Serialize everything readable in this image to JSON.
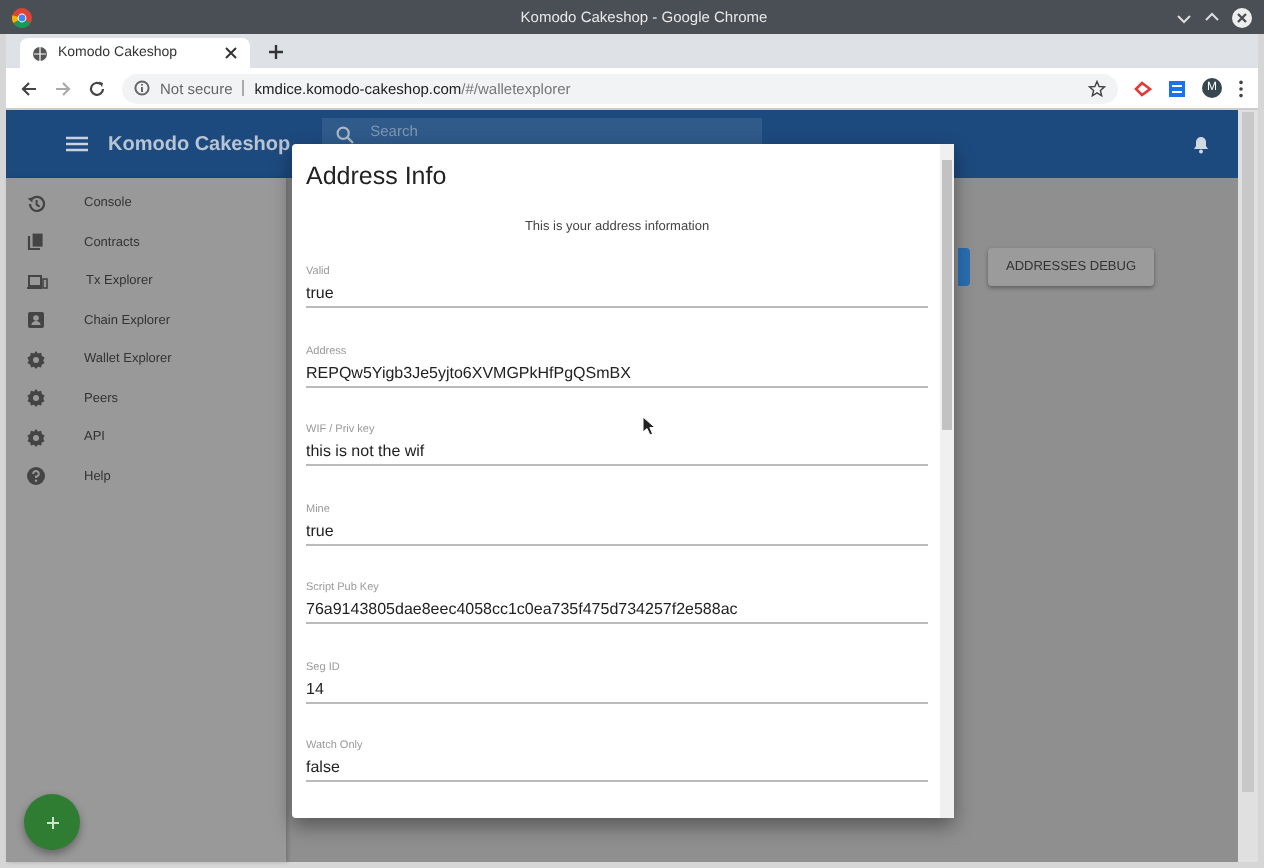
{
  "window": {
    "title": "Komodo Cakeshop - Google Chrome"
  },
  "browser": {
    "tab_title": "Komodo Cakeshop",
    "security": "Not secure",
    "url_host": "kmdice.komodo-cakeshop.com",
    "url_path": "/#/walletexplorer",
    "profile_initial": "M"
  },
  "header": {
    "title": "Komodo Cakeshop",
    "search": {
      "placeholder": "Search"
    }
  },
  "sidebar": {
    "items": [
      {
        "label": "Console",
        "kind": "history"
      },
      {
        "label": "Contracts",
        "kind": "copy"
      },
      {
        "label": "Tx Explorer",
        "kind": "devices"
      },
      {
        "label": "Chain Explorer",
        "kind": "contact"
      },
      {
        "label": "Wallet Explorer",
        "kind": "gear"
      },
      {
        "label": "Peers",
        "kind": "gear"
      },
      {
        "label": "API",
        "kind": "gear"
      },
      {
        "label": "Help",
        "kind": "help"
      }
    ]
  },
  "main": {
    "button": "ADDRESSES DEBUG"
  },
  "dialog": {
    "title": "Address Info",
    "subtitle": "This is your address information",
    "fields": [
      {
        "label": "Valid",
        "value": "true"
      },
      {
        "label": "Address",
        "value": "REPQw5Yigb3Je5yjto6XVMGPkHfPgQSmBX"
      },
      {
        "label": "WIF / Priv key",
        "value": "this is not the wif"
      },
      {
        "label": "Mine",
        "value": "true"
      },
      {
        "label": "Script Pub Key",
        "value": "76a9143805dae8eec4058cc1c0ea735f475d734257f2e588ac"
      },
      {
        "label": "Seg ID",
        "value": "14"
      },
      {
        "label": "Watch Only",
        "value": "false"
      }
    ]
  }
}
